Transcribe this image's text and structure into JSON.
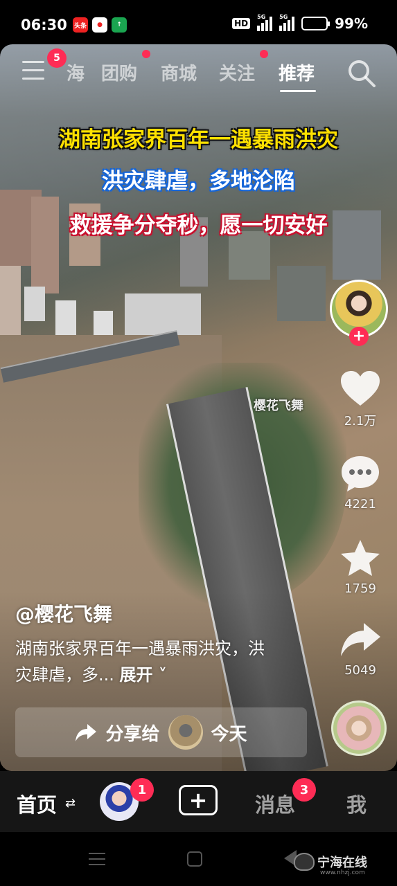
{
  "status_bar": {
    "time": "06:30",
    "notification_icons": [
      "toutiao-app-icon",
      "news-app-icon",
      "wechat-app-icon"
    ],
    "hd_label": "HD",
    "network_labels": [
      "5G",
      "5G"
    ],
    "battery_percent": "99%",
    "battery_level": 0.99
  },
  "top_nav": {
    "menu_badge": "5",
    "tabs": [
      {
        "label": "海",
        "active": false
      },
      {
        "label": "团购",
        "active": false,
        "dot": true
      },
      {
        "label": "商城",
        "active": false
      },
      {
        "label": "关注",
        "active": false,
        "dot": true
      },
      {
        "label": "推荐",
        "active": true
      }
    ]
  },
  "video": {
    "captions": [
      "湖南张家界百年一遇暴雨洪灾",
      "洪灾肆虐，多地沦陷",
      "救援争分夺秒，愿一切安好"
    ],
    "watermark": "樱花飞舞"
  },
  "actions": {
    "likes": "2.1万",
    "comments": "4221",
    "favorites": "1759",
    "shares": "5049"
  },
  "info": {
    "author": "@樱花飞舞",
    "description": "湖南张家界百年一遇暴雨洪灾，洪灾肆虐，多...",
    "expand_label": "展开"
  },
  "share_bar": {
    "label": "分享给",
    "when": "今天"
  },
  "tab_bar": {
    "home": "首页",
    "friend_badge": "1",
    "messages": "消息",
    "messages_badge": "3",
    "me": "我"
  },
  "site_watermark": {
    "name": "宁海在线",
    "url": "www.nhzj.com"
  },
  "colors": {
    "accent_red": "#fe2c55",
    "caption_yellow": "#ffe100",
    "caption_blue": "#1565d8",
    "caption_red": "#c8102e"
  }
}
